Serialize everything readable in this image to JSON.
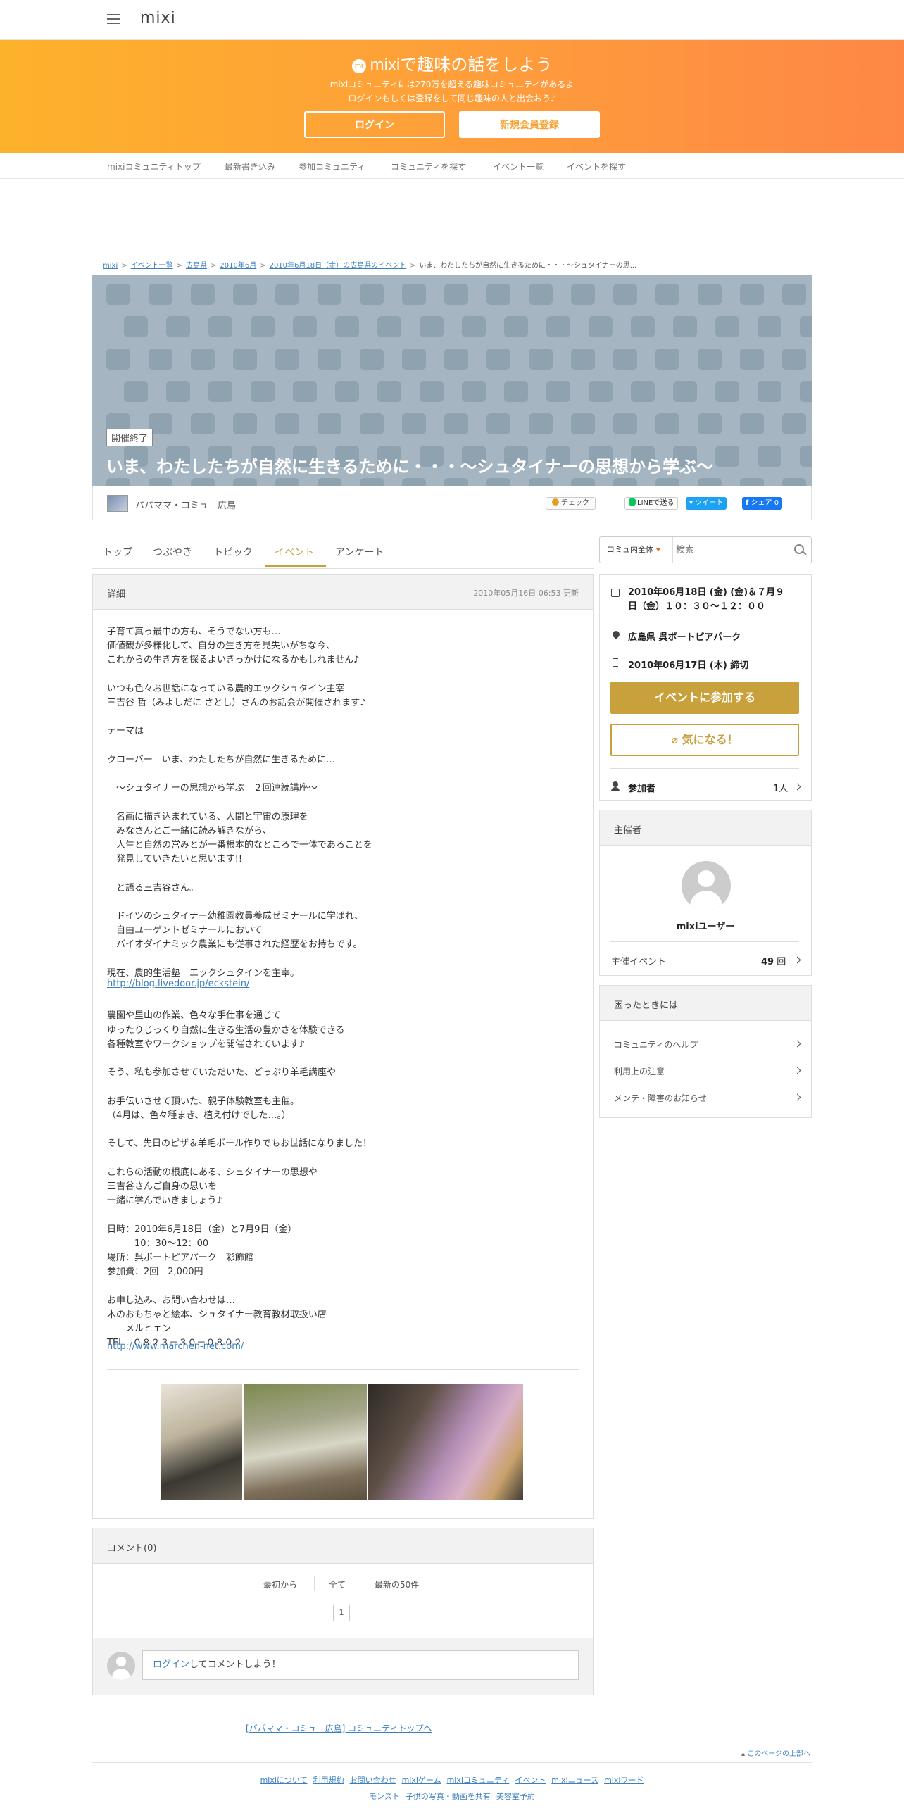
{
  "header": {
    "logo": "mixi"
  },
  "banner": {
    "icon_text": "mi",
    "title": "mixiで趣味の話をしよう",
    "sub1": "mixiコミュニティには270万を超える趣味コミュニティがあるよ",
    "sub2": "ログインもしくは登録をして同じ趣味の人と出会おう♪",
    "login": "ログイン",
    "register": "新規会員登録"
  },
  "subnav": [
    "mixiコミュニティトップ",
    "最新書き込み",
    "参加コミュニティ",
    "コミュニティを探す",
    "イベント一覧",
    "イベントを探す"
  ],
  "breadcrumb": {
    "items": [
      "mixi",
      "イベント一覧",
      "広島県",
      "2010年6月",
      "2010年6月18日（金）の広島県のイベント"
    ],
    "current": "いま、わたしたちが自然に生きるために・・・～シュタイナーの思..."
  },
  "event": {
    "status": "開催終了",
    "title": "いま、わたしたちが自然に生きるために・・・～シュタイナーの思想から学ぶ～",
    "community": "パパママ・コミュ　広島",
    "check": "チェック",
    "share_line": "LINEで送る",
    "share_tw": "ツイート",
    "share_fb": "シェア 0"
  },
  "tabs": [
    "トップ",
    "つぶやき",
    "トピック",
    "イベント",
    "アンケート"
  ],
  "search": {
    "scope": "コミュ内全体",
    "placeholder": "検索"
  },
  "detail": {
    "header": "詳細",
    "updated": "2010年05月16日 06:53 更新",
    "body": [
      "子育て真っ最中の方も、そうでない方も…",
      "価値観が多様化して、自分の生き方を見失いがちな今、",
      "これからの生き方を探るよいきっかけになるかもしれません♪",
      "",
      "いつも色々お世話になっている農的エックシュタイン主宰",
      "三吉谷 哲（みよしだに さとし）さんのお話会が開催されます♪",
      "",
      "テーマは",
      "",
      "クローバー　いま、わたしたちが自然に生きるために…",
      "",
      "　～シュタイナーの思想から学ぶ　２回連続講座～",
      "",
      "　名画に描き込まれている、人間と宇宙の原理を",
      "　みなさんとご一緒に読み解きながら、",
      "　人生と自然の営みとが一番根本的なところで一体であることを",
      "　発見していきたいと思います!!",
      "",
      "　と語る三吉谷さん。",
      "",
      "　ドイツのシュタイナー幼稚園教員養成ゼミナールに学ばれ、",
      "　自由ユーゲントゼミナールにおいて",
      "　バイオダイナミック農業にも従事された経歴をお持ちです。",
      "",
      "現在、農的生活塾　エックシュタインを主宰。",
      "",
      "",
      "農園や里山の作業、色々な手仕事を通じて",
      "ゆったりじっくり自然に生きる生活の豊かさを体験できる",
      "各種教室やワークショップを開催されています♪",
      "",
      "そう、私も参加させていただいた、どっぷり羊毛講座や",
      "",
      "お手伝いさせて頂いた、親子体験教室も主催。",
      "（4月は、色々種まき、植え付けでした…。）",
      "",
      "そして、先日のピザ＆羊毛ボール作りでもお世話になりました！",
      "",
      "これらの活動の根底にある、シュタイナーの思想や",
      "三吉谷さんご自身の思いを",
      "一緒に学んでいきましょう♪",
      "",
      "日時：2010年6月18日（金）と7月9日（金）",
      "　　　10：30～12：00",
      "場所：呉ポートピアパーク　彩飾館",
      "参加費：2回　2,000円",
      "",
      "お申し込み、お問い合わせは…",
      "木のおもちゃと絵本、シュタイナー教育教材取扱い店",
      "　　メルヒェン",
      "TEL　０８２３－３０－０８０２"
    ],
    "link1": "http://blog.livedoor.jp/eckstein/",
    "link2": "http://www.marchen-net.com/"
  },
  "comments": {
    "header": "コメント(0)",
    "first": "最初から",
    "all": "全て",
    "latest": "最新の50件",
    "page": "1",
    "login_link": "ログイン",
    "prompt": "してコメントしよう！"
  },
  "sidebar": {
    "date": "2010年06月18日 (金) (金)＆７月９日（金）１０：３０～１２：００",
    "date_l1": "2010年06月18日 (金) (金)＆７月９",
    "date_l2": "日（金）１０：３０～１２：００",
    "place": "広島県 呉ポートピアパーク",
    "deadline": "2010年06月17日 (木) 締切",
    "join": "イベントに参加する",
    "fav": "気になる！",
    "participants_label": "参加者",
    "participants": "1人",
    "organizer_header": "主催者",
    "organizer_name": "mixiユーザー",
    "organized_label": "主催イベント",
    "organized_count": "49",
    "organized_unit": "回",
    "help_header": "困ったときには",
    "help": [
      "コミュニティのヘルプ",
      "利用上の注意",
      "メンテ・障害のお知らせ"
    ]
  },
  "footer": {
    "back": "[パパママ・コミュ　広島] コミュニティトップへ",
    "top": "このページの上部へ",
    "row1": [
      "mixiについて",
      "利用規約",
      "お問い合わせ",
      "mixiゲーム",
      "mixiコミュニティ",
      "イベント",
      "mixiニュース",
      "mixiワード"
    ],
    "row2": [
      "モンスト",
      "子供の写真・動画を共有",
      "美容室予約"
    ]
  }
}
